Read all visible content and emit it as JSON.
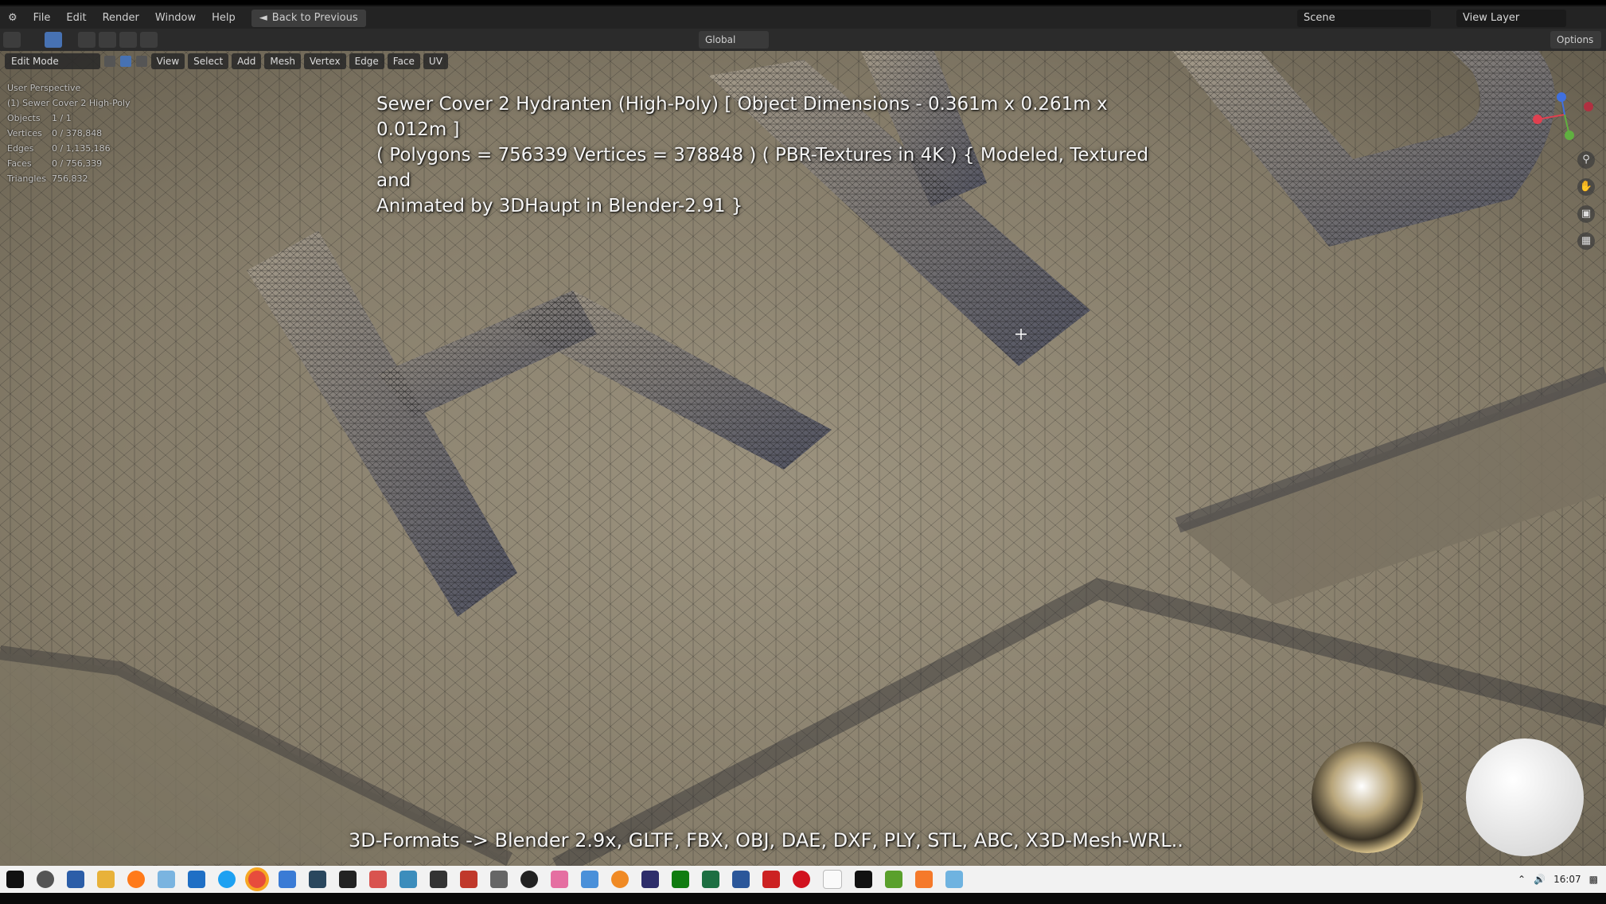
{
  "topbar": {
    "menus": [
      "File",
      "Edit",
      "Render",
      "Window",
      "Help"
    ],
    "back_label": "Back to Previous",
    "scene_label": "Scene",
    "view_layer_label": "View Layer"
  },
  "toolbar": {
    "orientation": "Global",
    "options_label": "Options"
  },
  "viewport": {
    "mode": "Edit Mode",
    "menus": [
      "View",
      "Select",
      "Add",
      "Mesh",
      "Vertex",
      "Edge",
      "Face",
      "UV"
    ],
    "perspective": "User Perspective",
    "object_name": "(1) Sewer Cover 2 High-Poly",
    "stats": [
      {
        "label": "Objects",
        "value": "1 / 1"
      },
      {
        "label": "Vertices",
        "value": "0 / 378,848"
      },
      {
        "label": "Edges",
        "value": "0 / 1,135,186"
      },
      {
        "label": "Faces",
        "value": "0 / 756,339"
      },
      {
        "label": "Triangles",
        "value": "756,832"
      }
    ]
  },
  "overlay": {
    "title_line1": "Sewer Cover 2 Hydranten (High-Poly) [ Object Dimensions -  0.361m x 0.261m x 0.012m ]",
    "title_line2": "( Polygons = 756339 Vertices = 378848 ) ( PBR-Textures in 4K ) { Modeled, Textured and",
    "title_line3": "Animated by 3DHaupt in Blender-2.91 }",
    "formats": "3D-Formats -> Blender 2.9x, GLTF, FBX, OBJ, DAE, DXF, PLY, STL, ABC, X3D-Mesh-WRL.."
  },
  "taskbar": {
    "time": "16:07",
    "icons": [
      "windows-start",
      "search",
      "save",
      "file-explorer",
      "firefox",
      "notepad",
      "outlook",
      "skype",
      "chrome",
      "app",
      "steam",
      "unity",
      "paint",
      "inkscape",
      "unity-hub",
      "acrobat",
      "app2",
      "obs",
      "app3",
      "blender-alt",
      "app4",
      "davinci",
      "xbox",
      "excel",
      "word",
      "app5",
      "opera",
      "notepad-doc",
      "cmd",
      "minecraft",
      "blender",
      "photos"
    ]
  },
  "colors": {
    "accent": "#4772b3",
    "surface": "#8f8672",
    "raised": "#6f6a5c"
  }
}
